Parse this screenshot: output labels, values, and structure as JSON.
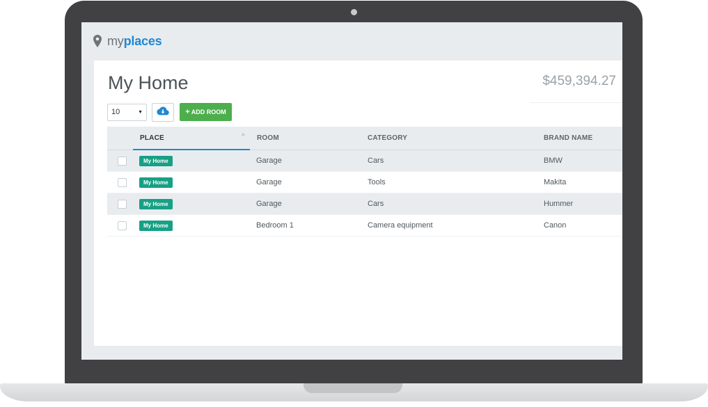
{
  "app": {
    "brand_my": "my",
    "brand_places": "places"
  },
  "page": {
    "title": "My Home",
    "total_value": "$459,394.27"
  },
  "toolbar": {
    "per_page_value": "10",
    "add_room_label": "ADD ROOM",
    "add_room_icon": "plus-icon",
    "download_icon": "cloud-download-icon"
  },
  "table": {
    "headers": {
      "place": "PLACE",
      "room": "ROOM",
      "category": "CATEGORY",
      "brand": "BRAND NAME"
    },
    "sort_indicator": "^",
    "rows": [
      {
        "place": "My Home",
        "room": "Garage",
        "category": "Cars",
        "brand": "BMW"
      },
      {
        "place": "My Home",
        "room": "Garage",
        "category": "Tools",
        "brand": "Makita"
      },
      {
        "place": "My Home",
        "room": "Garage",
        "category": "Cars",
        "brand": "Hummer"
      },
      {
        "place": "My Home",
        "room": "Bedroom 1",
        "category": "Camera equipment",
        "brand": "Canon"
      }
    ]
  },
  "colors": {
    "brand_blue": "#1e88d3",
    "tag_teal": "#17a085",
    "add_green": "#4cae4c",
    "frame_dark": "#414143"
  }
}
